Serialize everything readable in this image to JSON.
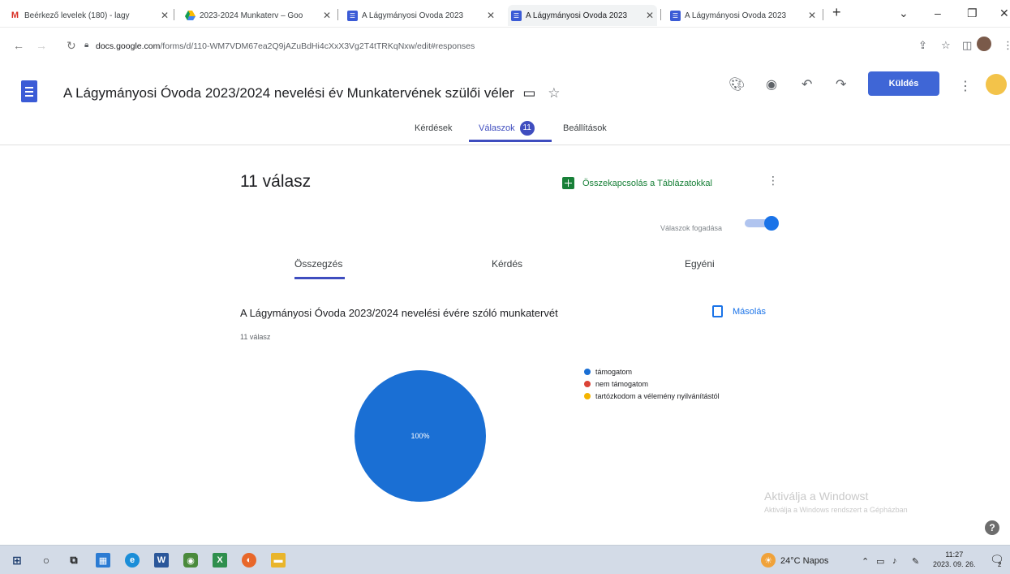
{
  "browser": {
    "tabs": [
      {
        "label": "Beérkező levelek (180) - lagy",
        "icon": "gmail-icon"
      },
      {
        "label": "2023-2024 Munkaterv – Goo",
        "icon": "drive-icon"
      },
      {
        "label": "A Lágymányosi Óvoda 2023",
        "icon": "forms-icon"
      },
      {
        "label": "A Lágymányosi Óvoda 2023",
        "icon": "forms-icon"
      },
      {
        "label": "A Lágymányosi Óvoda 2023",
        "icon": "forms-icon"
      }
    ],
    "url_domain": "docs.google.com",
    "url_path": "/forms/d/110-WM7VDM67ea2Q9jAZuBdHi4cXxX3Vg2T4tTRKqNxw/edit#responses"
  },
  "header": {
    "title": "A Lágymányosi Óvoda 2023/2024 nevelési év Munkatervének szülői véler",
    "send_label": "Küldés"
  },
  "main_tabs": {
    "questions": "Kérdések",
    "responses": "Válaszok",
    "responses_badge": "11",
    "settings": "Beállítások"
  },
  "responses": {
    "count_label": "11 válasz",
    "link_sheets": "Összekapcsolás a Táblázatokkal",
    "accepting_label": "Válaszok fogadása",
    "accepting": true
  },
  "sub_tabs": {
    "summary": "Összegzés",
    "question": "Kérdés",
    "individual": "Egyéni"
  },
  "question": {
    "title": "A Lágymányosi Óvoda 2023/2024 nevelési évére szóló munkatervét",
    "count": "11 válasz",
    "copy_label": "Másolás"
  },
  "chart_data": {
    "type": "pie",
    "categories": [
      "támogatom",
      "nem támogatom",
      "tartózkodom a vélemény nyilvánítástól"
    ],
    "values": [
      11,
      0,
      0
    ],
    "colors": [
      "#1a6fd4",
      "#db4437",
      "#f4b400"
    ],
    "slice_label": "100%",
    "legend_position": "right"
  },
  "watermark": {
    "line1": "Aktiválja a Windowst",
    "line2": "Aktiválja a Windows rendszert a Gépházban"
  },
  "taskbar": {
    "weather": "24°C Napos",
    "time": "11:27",
    "date": "2023. 09. 26.",
    "notifications": "2"
  }
}
